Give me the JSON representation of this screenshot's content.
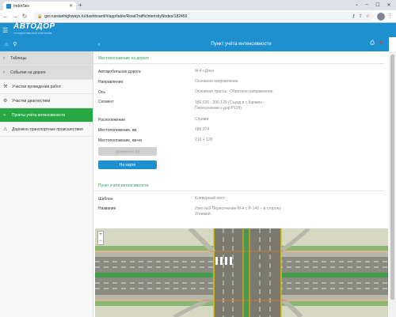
{
  "browser": {
    "tab_title": "IndorSev",
    "url": "gsr.russianhighways.ru/dashboard/#/app/table/RoadTrafficIntensityNodes/182450",
    "lock_icon": "lock-icon"
  },
  "app": {
    "logo": "АВТОДОР",
    "logo_sub": "ГОСУДАРСТВЕННАЯ КОМПАНИЯ",
    "page_title": "Пункт учёта интенсивности"
  },
  "sidebar": {
    "items": [
      {
        "label": "Таблицы",
        "icon": "chevron-left-icon"
      },
      {
        "label": "События на дороге",
        "icon": "chevron-left-icon"
      },
      {
        "label": "Участки проведения работ",
        "icon": "roadwork-icon"
      },
      {
        "label": "Участки диагностики",
        "icon": "diagnostics-icon"
      },
      {
        "label": "Пункты учёта интенсивности",
        "icon": "traffic-counter-icon"
      },
      {
        "label": "Дорожно-транспортные происшествия",
        "icon": "accident-icon"
      }
    ]
  },
  "location": {
    "section_title": "Местоположение на дороге",
    "fields": [
      {
        "label": "Автомобильная дорога",
        "value": "М-4 «Дон»"
      },
      {
        "label": "Направление",
        "value": "Основное направление"
      },
      {
        "label": "Ось",
        "value": "Основная трасса : Обратное направление"
      },
      {
        "label": "Сегмент",
        "value": "186,026 - 206,129 (Съезд в с.Кармен - Пересечение с дор.Р114)"
      },
      {
        "label": "Расположение",
        "value": "Справа"
      },
      {
        "label": "Местоположение, км",
        "value": "186,074"
      },
      {
        "label": "Местоположение, км+м",
        "value": "210 + 120"
      }
    ],
    "docs_button": "Документы (0)",
    "map_button": "На карте"
  },
  "counter": {
    "section_title": "Пункт учета интенсивности",
    "fields": [
      {
        "label": "Шаблон",
        "value": "Клеверный лист"
      },
      {
        "label": "Название",
        "value": "Узел №9 Пересечение М-4 с Р-140 – в сторону Уллевой"
      }
    ]
  },
  "map": {
    "zoom_in": "+",
    "zoom_out": "−"
  }
}
